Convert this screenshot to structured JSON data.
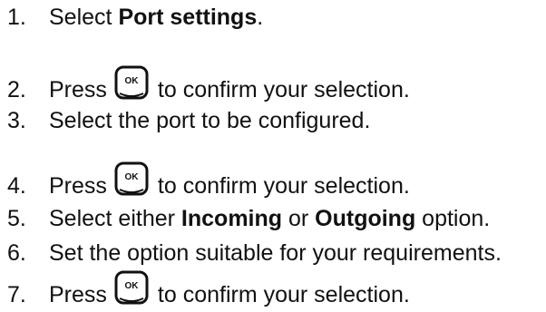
{
  "steps": [
    {
      "number": "1.",
      "parts": [
        "Select ",
        "Port settings",
        "."
      ]
    },
    {
      "number": "2.",
      "before": "Press",
      "after": "to confirm your selection.",
      "key_icon": "ok-key-icon",
      "key_label": "OK"
    },
    {
      "number": "3.",
      "text": "Select the port to be configured."
    },
    {
      "number": "4.",
      "before": "Press",
      "after": "to confirm your selection.",
      "key_icon": "ok-key-icon",
      "key_label": "OK"
    },
    {
      "number": "5.",
      "parts": [
        "Select either ",
        "Incoming",
        " or ",
        "Outgoing",
        " option."
      ]
    },
    {
      "number": "6.",
      "text": "Set the option suitable for your requirements."
    },
    {
      "number": "7.",
      "before": "Press",
      "after": "to confirm your selection.",
      "key_icon": "ok-key-icon",
      "key_label": "OK"
    }
  ]
}
